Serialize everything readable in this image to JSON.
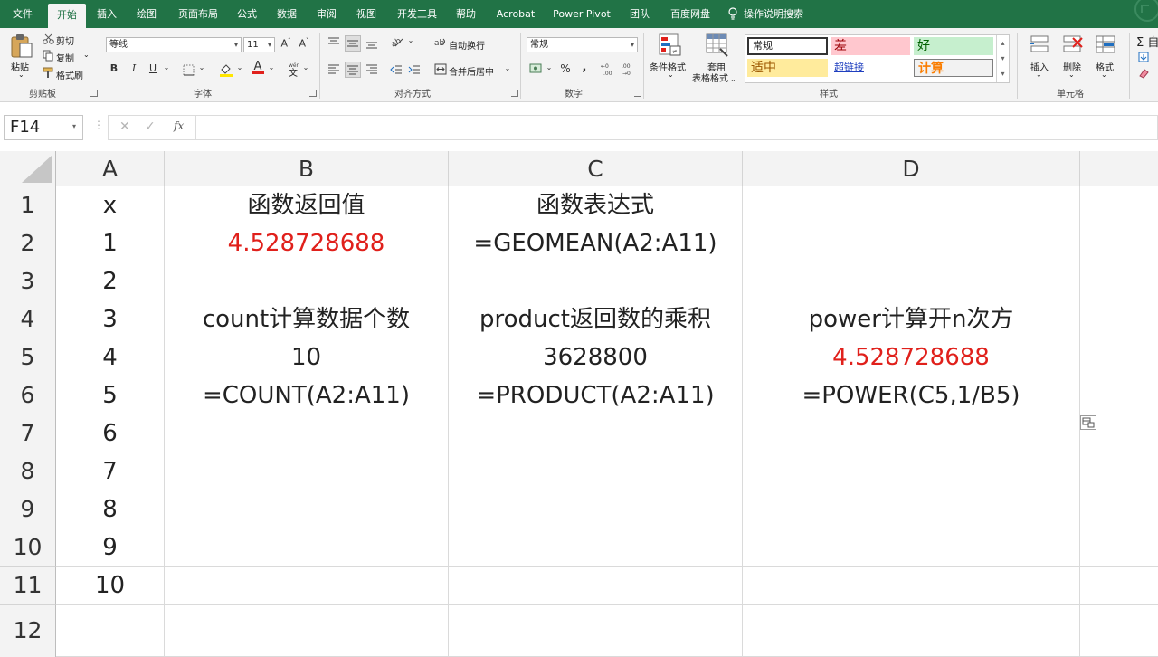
{
  "menu": {
    "items": [
      "文件",
      "开始",
      "插入",
      "绘图",
      "页面布局",
      "公式",
      "数据",
      "审阅",
      "视图",
      "开发工具",
      "帮助",
      "Acrobat",
      "Power Pivot",
      "团队",
      "百度网盘"
    ],
    "active": "开始",
    "search_label": "操作说明搜索"
  },
  "ribbon": {
    "clipboard": {
      "paste": "粘贴",
      "cut": "剪切",
      "copy": "复制",
      "format_painter": "格式刷",
      "label": "剪贴板"
    },
    "font": {
      "name": "等线",
      "size": "11",
      "bold": "B",
      "italic": "I",
      "underline": "U",
      "label": "字体"
    },
    "alignment": {
      "wrap": "自动换行",
      "merge": "合并后居中",
      "label": "对齐方式"
    },
    "number": {
      "format": "常规",
      "percent": "%",
      "comma": ",",
      "label": "数字"
    },
    "styles": {
      "conditional": "条件格式",
      "table_line1": "套用",
      "table_line2": "表格格式",
      "items": [
        "常规",
        "差",
        "好",
        "适中",
        "超链接",
        "计算"
      ],
      "label": "样式"
    },
    "cells": {
      "insert": "插入",
      "delete": "删除",
      "format": "格式",
      "label": "单元格"
    },
    "editing": {
      "sum": "Σ 自"
    }
  },
  "formula_bar": {
    "name_box": "F14",
    "fx": "fx",
    "formula": ""
  },
  "sheet": {
    "columns": [
      "A",
      "B",
      "C",
      "D"
    ],
    "rows": [
      "1",
      "2",
      "3",
      "4",
      "5",
      "6",
      "7",
      "8",
      "9",
      "10",
      "11",
      "12"
    ],
    "cells": {
      "A1": "x",
      "B1": "函数返回值",
      "C1": "函数表达式",
      "A2": "1",
      "B2": "4.528728688",
      "C2": "=GEOMEAN(A2:A11)",
      "A3": "2",
      "A4": "3",
      "B4": "count计算数据个数",
      "C4": "product返回数的乘积",
      "D4": "power计算开n次方",
      "A5": "4",
      "B5": "10",
      "C5": "3628800",
      "D5": "4.528728688",
      "A6": "5",
      "B6": "=COUNT(A2:A11)",
      "C6": "=PRODUCT(A2:A11)",
      "D6": "=POWER(C5,1/B5)",
      "A7": "6",
      "A8": "7",
      "A9": "8",
      "A10": "9",
      "A11": "10"
    },
    "highlight_color": "#e0201b"
  }
}
